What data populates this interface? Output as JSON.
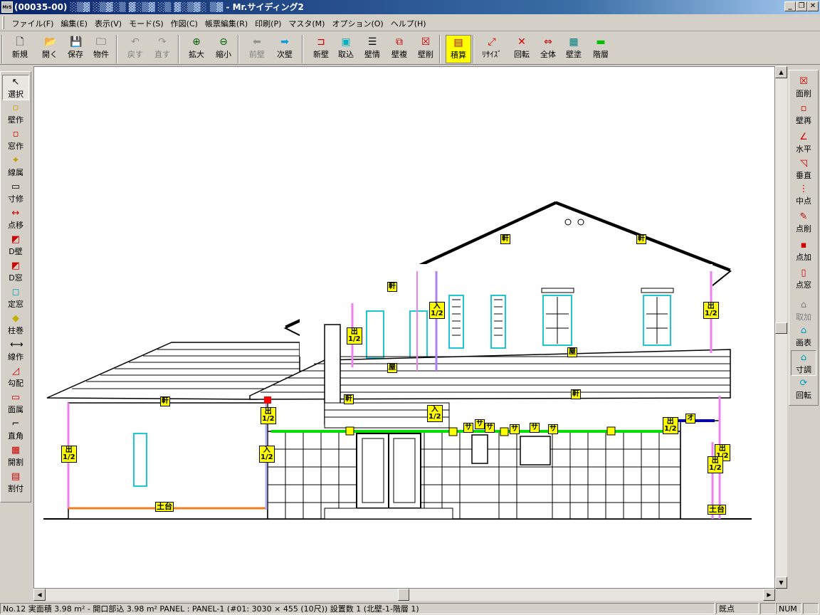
{
  "window": {
    "title_prefix": "(00035-00)",
    "title_suffix": "- Mr.サイディング2",
    "app_icon": "app-icon"
  },
  "menu": [
    "ファイル(F)",
    "編集(E)",
    "表示(V)",
    "モード(S)",
    "作図(C)",
    "帳票編集(R)",
    "印刷(P)",
    "マスタ(M)",
    "オプション(O)",
    "ヘルプ(H)"
  ],
  "toolbar": [
    {
      "label": "新規",
      "icon": "new-file-icon",
      "enabled": true
    },
    {
      "label": "開く",
      "icon": "open-folder-icon",
      "enabled": true
    },
    {
      "label": "保存",
      "icon": "save-disk-icon",
      "enabled": true
    },
    {
      "label": "物件",
      "icon": "property-icon",
      "enabled": true
    },
    {
      "label": "戻す",
      "icon": "undo-icon",
      "enabled": false
    },
    {
      "label": "直す",
      "icon": "redo-icon",
      "enabled": false
    },
    {
      "label": "拡大",
      "icon": "zoom-in-icon",
      "enabled": true
    },
    {
      "label": "縮小",
      "icon": "zoom-out-icon",
      "enabled": true
    },
    {
      "label": "前壁",
      "icon": "prev-wall-icon",
      "enabled": false
    },
    {
      "label": "次壁",
      "icon": "next-wall-icon",
      "enabled": true
    },
    {
      "label": "新壁",
      "icon": "new-wall-icon",
      "enabled": true
    },
    {
      "label": "取込",
      "icon": "import-icon",
      "enabled": true
    },
    {
      "label": "壁情",
      "icon": "wall-info-icon",
      "enabled": true
    },
    {
      "label": "壁複",
      "icon": "wall-copy-icon",
      "enabled": true
    },
    {
      "label": "壁削",
      "icon": "wall-delete-icon",
      "enabled": true
    },
    {
      "label": "積算",
      "icon": "estimate-icon",
      "enabled": true
    },
    {
      "label": "ﾘｻｲｽﾞ",
      "icon": "resize-icon",
      "enabled": true
    },
    {
      "label": "回転",
      "icon": "rotate-icon",
      "enabled": true
    },
    {
      "label": "全体",
      "icon": "fit-all-icon",
      "enabled": true
    },
    {
      "label": "壁塗",
      "icon": "wall-paint-icon",
      "enabled": true
    },
    {
      "label": "階層",
      "icon": "layer-icon",
      "enabled": true
    }
  ],
  "left_tools": [
    {
      "label": "選択",
      "icon": "select-arrow-icon",
      "selected": true
    },
    {
      "label": "壁作",
      "icon": "wall-create-icon"
    },
    {
      "label": "窓作",
      "icon": "window-create-icon"
    },
    {
      "label": "線属",
      "icon": "line-attr-icon"
    },
    {
      "label": "寸修",
      "icon": "dimension-edit-icon"
    },
    {
      "label": "点移",
      "icon": "point-move-icon"
    },
    {
      "label": "D壁",
      "icon": "d-wall-icon"
    },
    {
      "label": "D窓",
      "icon": "d-window-icon"
    },
    {
      "label": "定窓",
      "icon": "fixed-window-icon"
    },
    {
      "label": "柱巻",
      "icon": "pillar-wrap-icon"
    },
    {
      "label": "線作",
      "icon": "line-create-icon"
    },
    {
      "label": "勾配",
      "icon": "slope-icon"
    },
    {
      "label": "面属",
      "icon": "face-attr-icon"
    },
    {
      "label": "直角",
      "icon": "right-angle-icon"
    },
    {
      "label": "開割",
      "icon": "opening-split-icon"
    },
    {
      "label": "割付",
      "icon": "layout-icon"
    }
  ],
  "right_tools": [
    {
      "label": "面削",
      "icon": "face-delete-icon",
      "enabled": true
    },
    {
      "label": "壁再",
      "icon": "wall-redo-icon",
      "enabled": true
    },
    {
      "label": "水平",
      "icon": "horizontal-icon",
      "enabled": true
    },
    {
      "label": "垂直",
      "icon": "vertical-icon",
      "enabled": true
    },
    {
      "label": "中点",
      "icon": "midpoint-icon",
      "enabled": true
    },
    {
      "label": "点削",
      "icon": "point-delete-icon",
      "enabled": true
    },
    {
      "label": "点加",
      "icon": "point-add-icon",
      "enabled": true
    },
    {
      "label": "点窓",
      "icon": "point-window-icon",
      "enabled": true
    },
    {
      "label": "取加",
      "icon": "import-add-icon",
      "enabled": false
    },
    {
      "label": "画表",
      "icon": "screen-display-icon",
      "enabled": true
    },
    {
      "label": "寸調",
      "icon": "dimension-adjust-icon",
      "enabled": true
    },
    {
      "label": "回転",
      "icon": "rotate-view-icon",
      "enabled": true
    }
  ],
  "drawing_labels": {
    "eave": "軒",
    "roof": "屋",
    "out_half": "出\n1/2",
    "in_half": "入\n1/2",
    "sill": "土台",
    "sa": "サ",
    "o": "オ"
  },
  "colors": {
    "window_frame": "#1ec8d2",
    "label_bg": "#ffff00",
    "pink_line": "#f080f0",
    "green_line": "#00e000",
    "orange_line": "#f08020",
    "blue_line": "#0000c0"
  },
  "status": {
    "info": "No.12 実面積 3.98 m² - 開口部込 3.98 m²  PANEL : PANEL-1 (#01: 3030 × 455 (10尺)) 設置数 1 (北壁-1-階層 1)",
    "mode": "既点",
    "num": "NUM"
  }
}
